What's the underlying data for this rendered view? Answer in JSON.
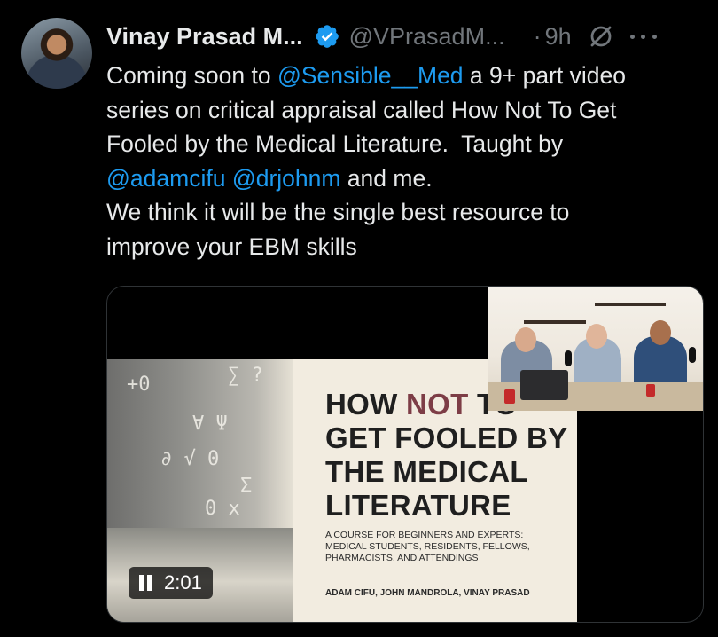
{
  "author": {
    "name": "Vinay Prasad M...",
    "handle": "@VPrasadM...",
    "separator": "·",
    "time": "9h"
  },
  "icons": {
    "verified": "verified-badge-icon",
    "grok": "grok-icon",
    "more": "more-options-icon"
  },
  "colors": {
    "accent": "#1d9bf0",
    "text": "#e7e9ea",
    "muted": "#71767b",
    "background": "#000000"
  },
  "tweet": {
    "line1_a": "Coming soon to ",
    "line1_mention": "@Sensible__Med",
    "line1_b": " a 9+ part video",
    "line2": "series on critical appraisal called How Not To Get",
    "line3": "Fooled by the Medical Literature.  Taught by",
    "line4_mention1": "@adamcifu",
    "line4_mention2": "@drjohnm",
    "line4_b": " and me.",
    "line5": "We think it will be the single best resource to",
    "line6": "improve your EBM skills"
  },
  "video": {
    "slide_title_1a": "HOW ",
    "slide_title_1b": "NOT",
    "slide_title_1c": " TO",
    "slide_title_2": "GET FOOLED BY",
    "slide_title_3": "THE MEDICAL",
    "slide_title_4": "LITERATURE",
    "slide_subtitle": "A course for beginners and experts: medical students, residents, fellows, pharmacists, and attendings",
    "slide_authors": "Adam Cifu, John Mandrola, Vinay Prasad",
    "elapsed": "2:01"
  }
}
